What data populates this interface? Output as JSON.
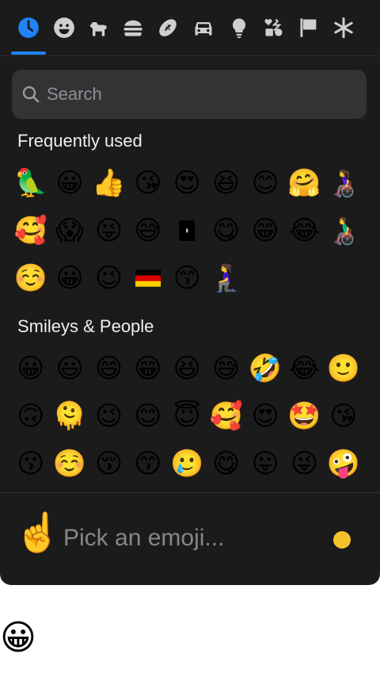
{
  "tabs": [
    {
      "name": "recent",
      "icon": "clock-icon",
      "active": true
    },
    {
      "name": "smileys",
      "icon": "smiley-icon"
    },
    {
      "name": "animals",
      "icon": "dog-icon"
    },
    {
      "name": "food",
      "icon": "burger-icon"
    },
    {
      "name": "activity",
      "icon": "football-icon"
    },
    {
      "name": "travel",
      "icon": "car-icon"
    },
    {
      "name": "objects",
      "icon": "lightbulb-icon"
    },
    {
      "name": "symbols",
      "icon": "symbols-icon"
    },
    {
      "name": "flags",
      "icon": "flag-icon"
    },
    {
      "name": "custom",
      "icon": "asterisk-icon"
    }
  ],
  "colors": {
    "accent": "#1e84f7",
    "panel": "#1b1b1c",
    "search_bg": "#333335",
    "tone": "#f5c32b"
  },
  "search": {
    "placeholder": "Search"
  },
  "sections": [
    {
      "title": "Frequently used",
      "emojis": [
        "🦜",
        "😀",
        "👍",
        "😘",
        "😍",
        "😆",
        "😊",
        "🤗",
        "👩‍🦽",
        "🥰",
        "😱",
        "😜",
        "😅",
        "▮",
        "😋",
        "😁",
        "😂",
        "👨‍🦽",
        "☺️",
        "😀",
        "😉",
        "🇩🇪",
        "😙",
        "🧎‍♀️"
      ]
    },
    {
      "title": "Smileys & People",
      "emojis": [
        "😀",
        "😃",
        "😄",
        "😁",
        "😆",
        "😅",
        "🤣",
        "😂",
        "🙂",
        "🙃",
        "🫠",
        "😉",
        "😊",
        "😇",
        "🥰",
        "😍",
        "🤩",
        "😘",
        "😗",
        "☺️",
        "😚",
        "😙",
        "🥲",
        "😋",
        "😛",
        "😜",
        "🤪"
      ]
    }
  ],
  "footer": {
    "preview_emoji": "☝️",
    "placeholder": "Pick an emoji..."
  },
  "below": {
    "emoji": "😀"
  }
}
